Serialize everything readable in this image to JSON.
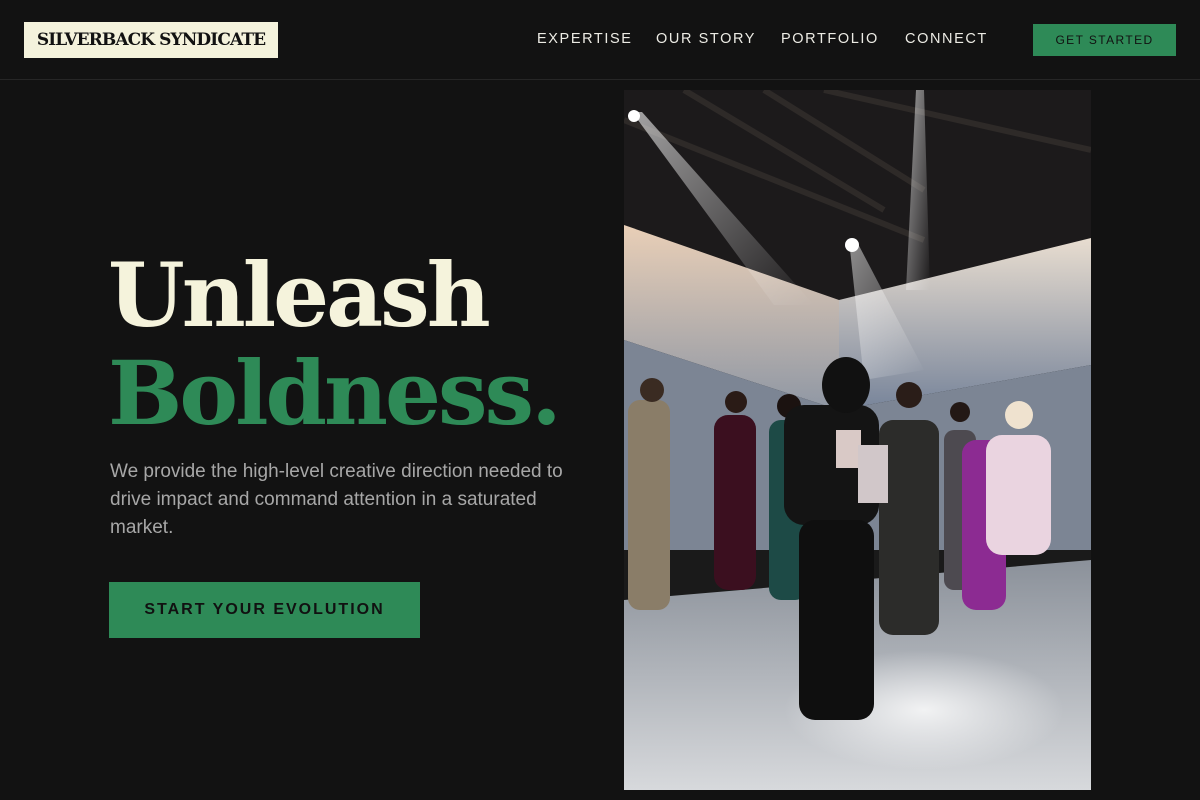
{
  "header": {
    "logo": "SILVERBACK SYNDICATE",
    "nav": [
      "EXPERTISE",
      "OUR STORY",
      "PORTFOLIO",
      "CONNECT"
    ],
    "cta": "GET STARTED"
  },
  "hero": {
    "title_line1": "Unleash",
    "title_line2": "Boldness.",
    "subtitle": "We provide the high-level creative direction needed to drive impact and command attention in a saturated market.",
    "cta": "START YOUR EVOLUTION"
  },
  "photo": {
    "subject": "fashion-show-backstage-photo"
  },
  "colors": {
    "background": "#121212",
    "accent_green": "#2e8a57",
    "cream": "#f5f3dc",
    "muted_text": "#a7a7a7"
  }
}
